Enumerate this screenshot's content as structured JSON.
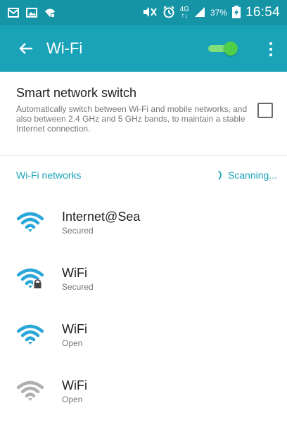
{
  "status_bar": {
    "network_type": "4G",
    "network_sub": "↑↓",
    "battery_percent": "37%",
    "time": "16:54"
  },
  "action_bar": {
    "title": "Wi-Fi",
    "wifi_enabled": true
  },
  "smart_switch": {
    "title": "Smart network switch",
    "description": "Automatically switch between Wi-Fi and mobile networks, and also between 2.4 GHz and 5 GHz bands, to maintain a stable Internet connection.",
    "checked": false
  },
  "networks_header": {
    "label": "Wi-Fi networks",
    "scanning": "Scanning..."
  },
  "networks": [
    {
      "name": "Internet@Sea",
      "status": "Secured",
      "icon": "wifi-full-icon"
    },
    {
      "name": "WiFi",
      "status": "Secured",
      "icon": "wifi-locked-icon"
    },
    {
      "name": "WiFi",
      "status": "Open",
      "icon": "wifi-full-icon"
    },
    {
      "name": "WiFi",
      "status": "Open",
      "icon": "wifi-weak-icon"
    }
  ],
  "colors": {
    "status_bar": "#1594a6",
    "action_bar": "#1aa3b8",
    "accent": "#1aa3b8",
    "toggle_on": "#4fcf4a",
    "wifi_icon": "#2aa7d8",
    "wifi_icon_inactive": "#b0b0b0"
  }
}
